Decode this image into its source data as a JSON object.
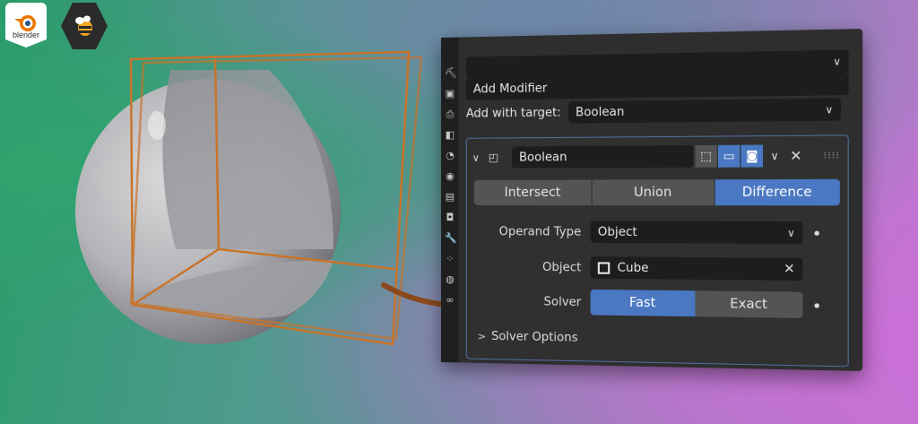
{
  "logos": {
    "blender_wordmark": "blender"
  },
  "sidebar_icons": [
    "tool-icon",
    "render-icon",
    "output-icon",
    "view-layer-icon",
    "scene-icon",
    "world-icon",
    "collection-icon",
    "object-icon",
    "modifier-icon",
    "particles-icon",
    "physics-icon",
    "constraints-icon"
  ],
  "panel": {
    "add_modifier": "Add Modifier",
    "add_with_target_label": "Add with target:",
    "add_with_target_value": "Boolean"
  },
  "modifier": {
    "name": "Boolean",
    "operations": [
      {
        "label": "Intersect",
        "active": false
      },
      {
        "label": "Union",
        "active": false
      },
      {
        "label": "Difference",
        "active": true
      }
    ],
    "operand_type_label": "Operand Type",
    "operand_type_value": "Object",
    "object_label": "Object",
    "object_value": "Cube",
    "solver_label": "Solver",
    "solvers": [
      {
        "label": "Fast",
        "active": true
      },
      {
        "label": "Exact",
        "active": false
      }
    ],
    "solver_options_label": "Solver Options"
  },
  "colors": {
    "accent": "#4a78c2",
    "cube_outline": "#c8742a",
    "panel_bg": "#2e2e2e"
  }
}
